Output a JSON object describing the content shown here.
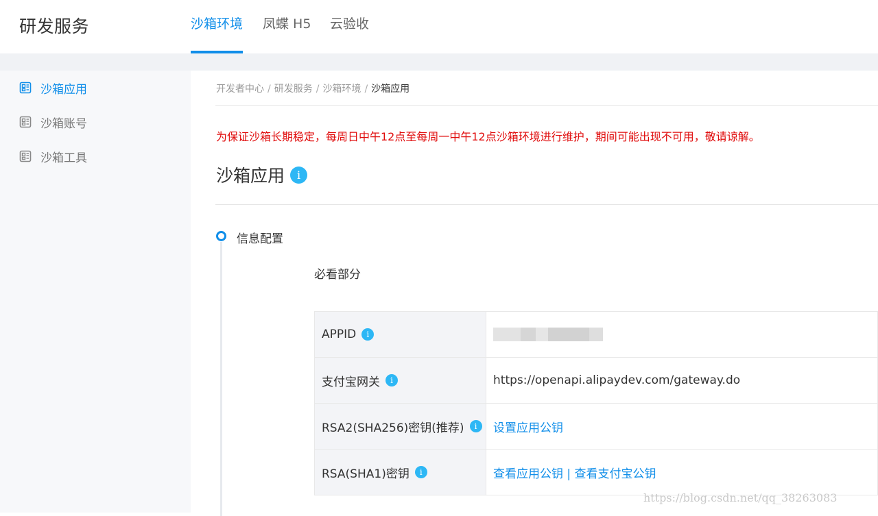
{
  "header": {
    "brand": "研发服务",
    "tabs": [
      {
        "label": "沙箱环境",
        "active": true
      },
      {
        "label": "凤蝶 H5",
        "active": false
      },
      {
        "label": "云验收",
        "active": false
      }
    ]
  },
  "sidebar": {
    "items": [
      {
        "label": "沙箱应用",
        "icon": "app-icon",
        "active": true
      },
      {
        "label": "沙箱账号",
        "icon": "account-icon",
        "active": false
      },
      {
        "label": "沙箱工具",
        "icon": "tool-icon",
        "active": false
      }
    ]
  },
  "breadcrumb": [
    "开发者中心",
    "研发服务",
    "沙箱环境",
    "沙箱应用"
  ],
  "notice": "为保证沙箱长期稳定，每周日中午12点至每周一中午12点沙箱环境进行维护，期间可能出现不可用，敬请谅解。",
  "page_title": "沙箱应用",
  "step": {
    "label": "信息配置"
  },
  "section_label": "必看部分",
  "config": {
    "rows": [
      {
        "key": "APPID",
        "value": "",
        "masked": true
      },
      {
        "key": "支付宝网关",
        "value": "https://openapi.alipaydev.com/gateway.do"
      },
      {
        "key": "RSA2(SHA256)密钥(推荐)",
        "link": "设置应用公钥"
      },
      {
        "key": "RSA(SHA1)密钥",
        "link1": "查看应用公钥",
        "separator": " | ",
        "link2": "查看支付宝公钥"
      }
    ]
  },
  "info_glyph": "i",
  "watermark": "https://blog.csdn.net/qq_38263083",
  "colors": {
    "accent": "#108ee9",
    "notice": "#e00b0b",
    "info": "#2db7f5"
  }
}
